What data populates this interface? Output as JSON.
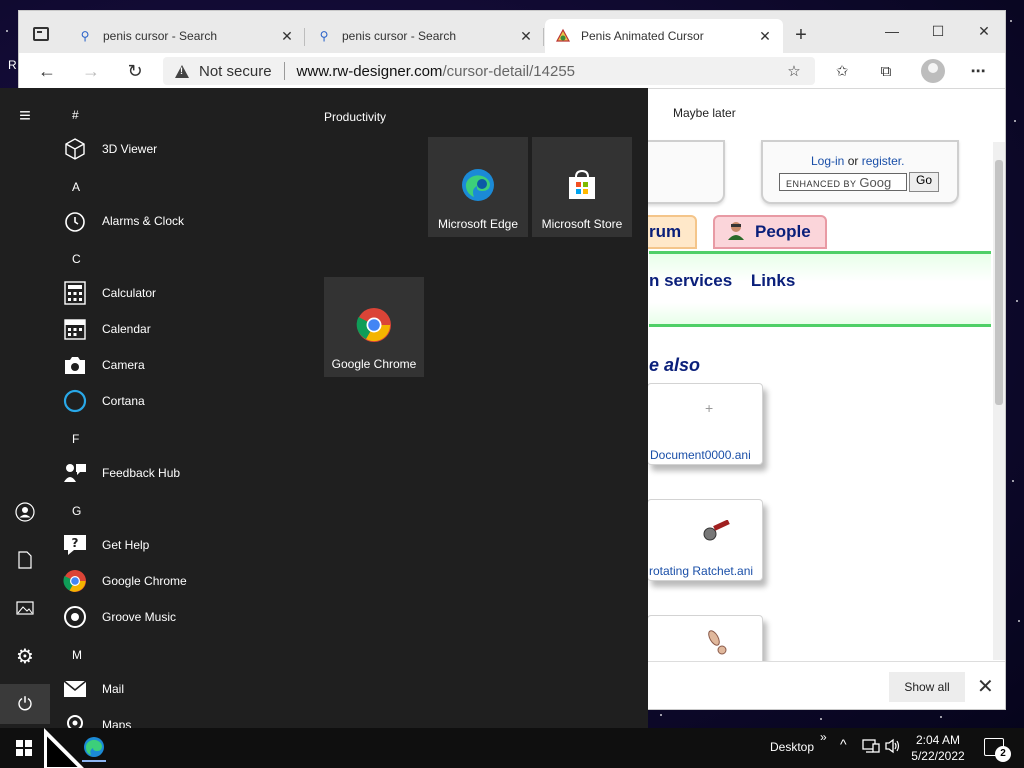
{
  "desktop": {
    "edge_char": "R"
  },
  "browser": {
    "tabs": [
      {
        "title": "penis cursor - Search",
        "icon": "search-icon"
      },
      {
        "title": "penis cursor - Search",
        "icon": "search-icon"
      },
      {
        "title": "Penis Animated Cursor",
        "icon": "site-favicon"
      }
    ],
    "new_tab": "+",
    "address": {
      "security": "Not secure",
      "host": "www.rw-designer.com",
      "path": "/cursor-detail/14255"
    },
    "page": {
      "maybe_later": "Maybe later",
      "login": "Log-in",
      "or": "or",
      "register": "register.",
      "search_label": "ENHANCED BY",
      "search_brand": "Goog",
      "search_go": "Go",
      "nav_forum": "rum",
      "nav_people": "People",
      "band_services": "n services",
      "band_links": "Links",
      "see_also": "e also",
      "cards": [
        {
          "name": "Document0000.ani"
        },
        {
          "name": "rotating Ratchet.ani"
        },
        {
          "name": ""
        }
      ]
    },
    "download_bar": {
      "show_all": "Show all"
    }
  },
  "start_menu": {
    "letters": [
      "#",
      "A",
      "C",
      "F",
      "G",
      "M"
    ],
    "apps": [
      {
        "label": "3D Viewer",
        "icon": "cube-icon"
      },
      {
        "label": "Alarms & Clock",
        "icon": "alarm-clock-icon"
      },
      {
        "label": "Calculator",
        "icon": "calculator-icon"
      },
      {
        "label": "Calendar",
        "icon": "calendar-icon"
      },
      {
        "label": "Camera",
        "icon": "camera-icon"
      },
      {
        "label": "Cortana",
        "icon": "cortana-icon"
      },
      {
        "label": "Feedback Hub",
        "icon": "feedback-icon"
      },
      {
        "label": "Get Help",
        "icon": "help-icon"
      },
      {
        "label": "Google Chrome",
        "icon": "chrome-icon"
      },
      {
        "label": "Groove Music",
        "icon": "music-icon"
      },
      {
        "label": "Mail",
        "icon": "mail-icon"
      },
      {
        "label": "Maps",
        "icon": "maps-icon"
      }
    ],
    "group_title": "Productivity",
    "tiles": [
      {
        "label": "Microsoft Edge",
        "icon": "edge-icon"
      },
      {
        "label": "Microsoft Store",
        "icon": "store-icon"
      },
      {
        "label": "Google Chrome",
        "icon": "chrome-icon"
      }
    ]
  },
  "taskbar": {
    "desktop_label": "Desktop",
    "time": "2:04 AM",
    "date": "5/22/2022",
    "notification_count": "2"
  }
}
